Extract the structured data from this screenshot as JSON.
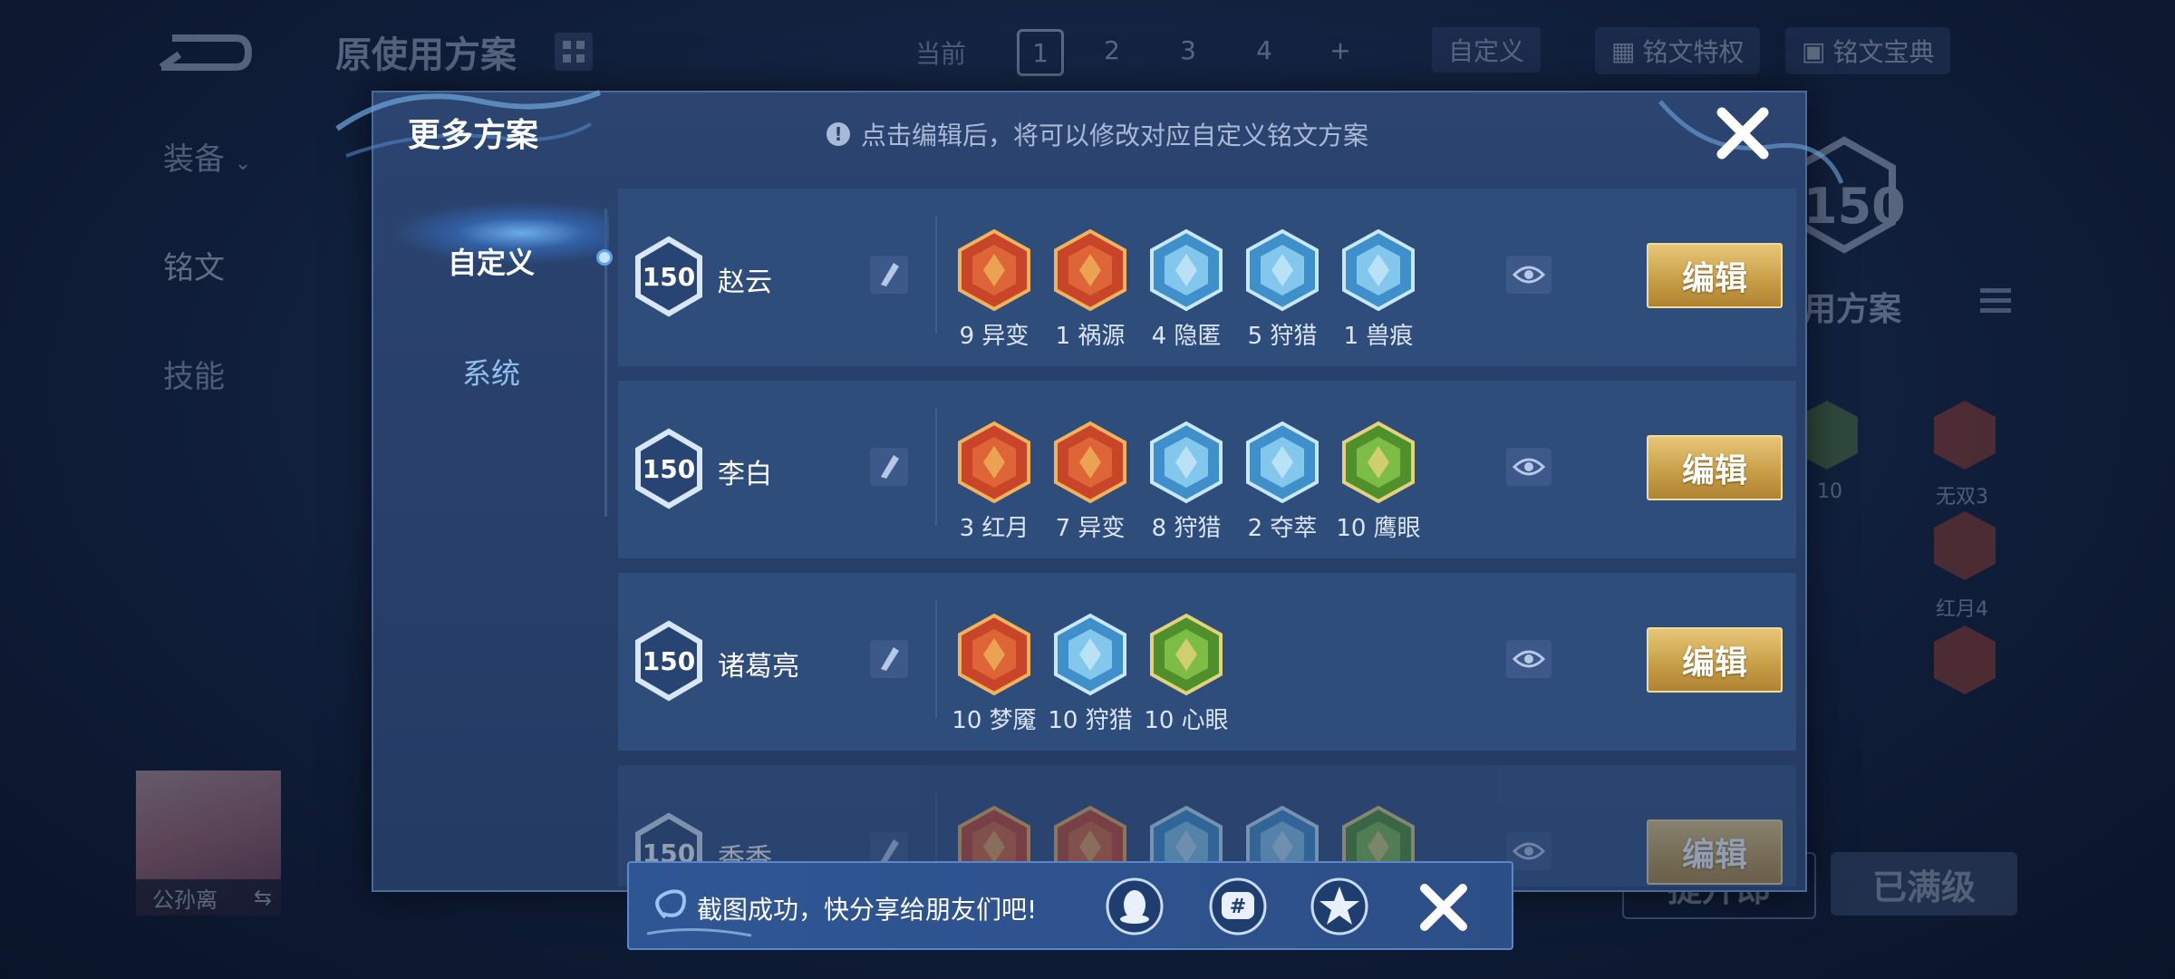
{
  "background": {
    "plan_title": "原使用方案",
    "current_label": "当前",
    "pages": [
      "1",
      "2",
      "3",
      "4",
      "+"
    ],
    "active_page": "1",
    "custom_label": "自定义",
    "rune_privilege_label": "铭文特权",
    "rune_guide_label": "铭文宝典",
    "side_items": [
      "装备",
      "铭文",
      "技能"
    ],
    "level": "150",
    "use_plan_label": "用方案",
    "rune_labels": [
      "10",
      "无双3",
      "红月4"
    ],
    "hero_name": "公孙离",
    "upgrade_label": "提升郎",
    "maxed_label": "已满级"
  },
  "modal": {
    "title": "更多方案",
    "hint": "点击编辑后，将可以修改对应自定义铭文方案",
    "tabs": [
      "自定义",
      "系统"
    ],
    "edit_label": "编辑",
    "plans": [
      {
        "level": "150",
        "hero": "赵云",
        "runes": [
          {
            "count": "9",
            "name": "异变",
            "color": "red"
          },
          {
            "count": "1",
            "name": "祸源",
            "color": "red"
          },
          {
            "count": "4",
            "name": "隐匿",
            "color": "blue"
          },
          {
            "count": "5",
            "name": "狩猎",
            "color": "blue"
          },
          {
            "count": "1",
            "name": "兽痕",
            "color": "blue"
          }
        ]
      },
      {
        "level": "150",
        "hero": "李白",
        "runes": [
          {
            "count": "3",
            "name": "红月",
            "color": "red"
          },
          {
            "count": "7",
            "name": "异变",
            "color": "red"
          },
          {
            "count": "8",
            "name": "狩猎",
            "color": "blue"
          },
          {
            "count": "2",
            "name": "夺萃",
            "color": "blue"
          },
          {
            "count": "10",
            "name": "鹰眼",
            "color": "green"
          }
        ]
      },
      {
        "level": "150",
        "hero": "诸葛亮",
        "runes": [
          {
            "count": "10",
            "name": "梦魇",
            "color": "red"
          },
          {
            "count": "10",
            "name": "狩猎",
            "color": "blue"
          },
          {
            "count": "10",
            "name": "心眼",
            "color": "green"
          }
        ]
      },
      {
        "level": "150",
        "hero": "香香",
        "runes": [
          {
            "count": "",
            "name": "",
            "color": "red"
          },
          {
            "count": "",
            "name": "",
            "color": "red"
          },
          {
            "count": "",
            "name": "",
            "color": "blue"
          },
          {
            "count": "",
            "name": "",
            "color": "blue"
          },
          {
            "count": "",
            "name": "",
            "color": "green"
          }
        ]
      }
    ]
  },
  "toast": {
    "message": "截图成功，快分享给朋友们吧!",
    "share_targets": [
      "qq-icon",
      "moments-icon",
      "qzone-icon"
    ]
  },
  "colors": {
    "gold": "#c9a049",
    "red_rune": "#d2482a",
    "blue_rune": "#5bb3e6",
    "green_rune": "#6fb43c"
  }
}
